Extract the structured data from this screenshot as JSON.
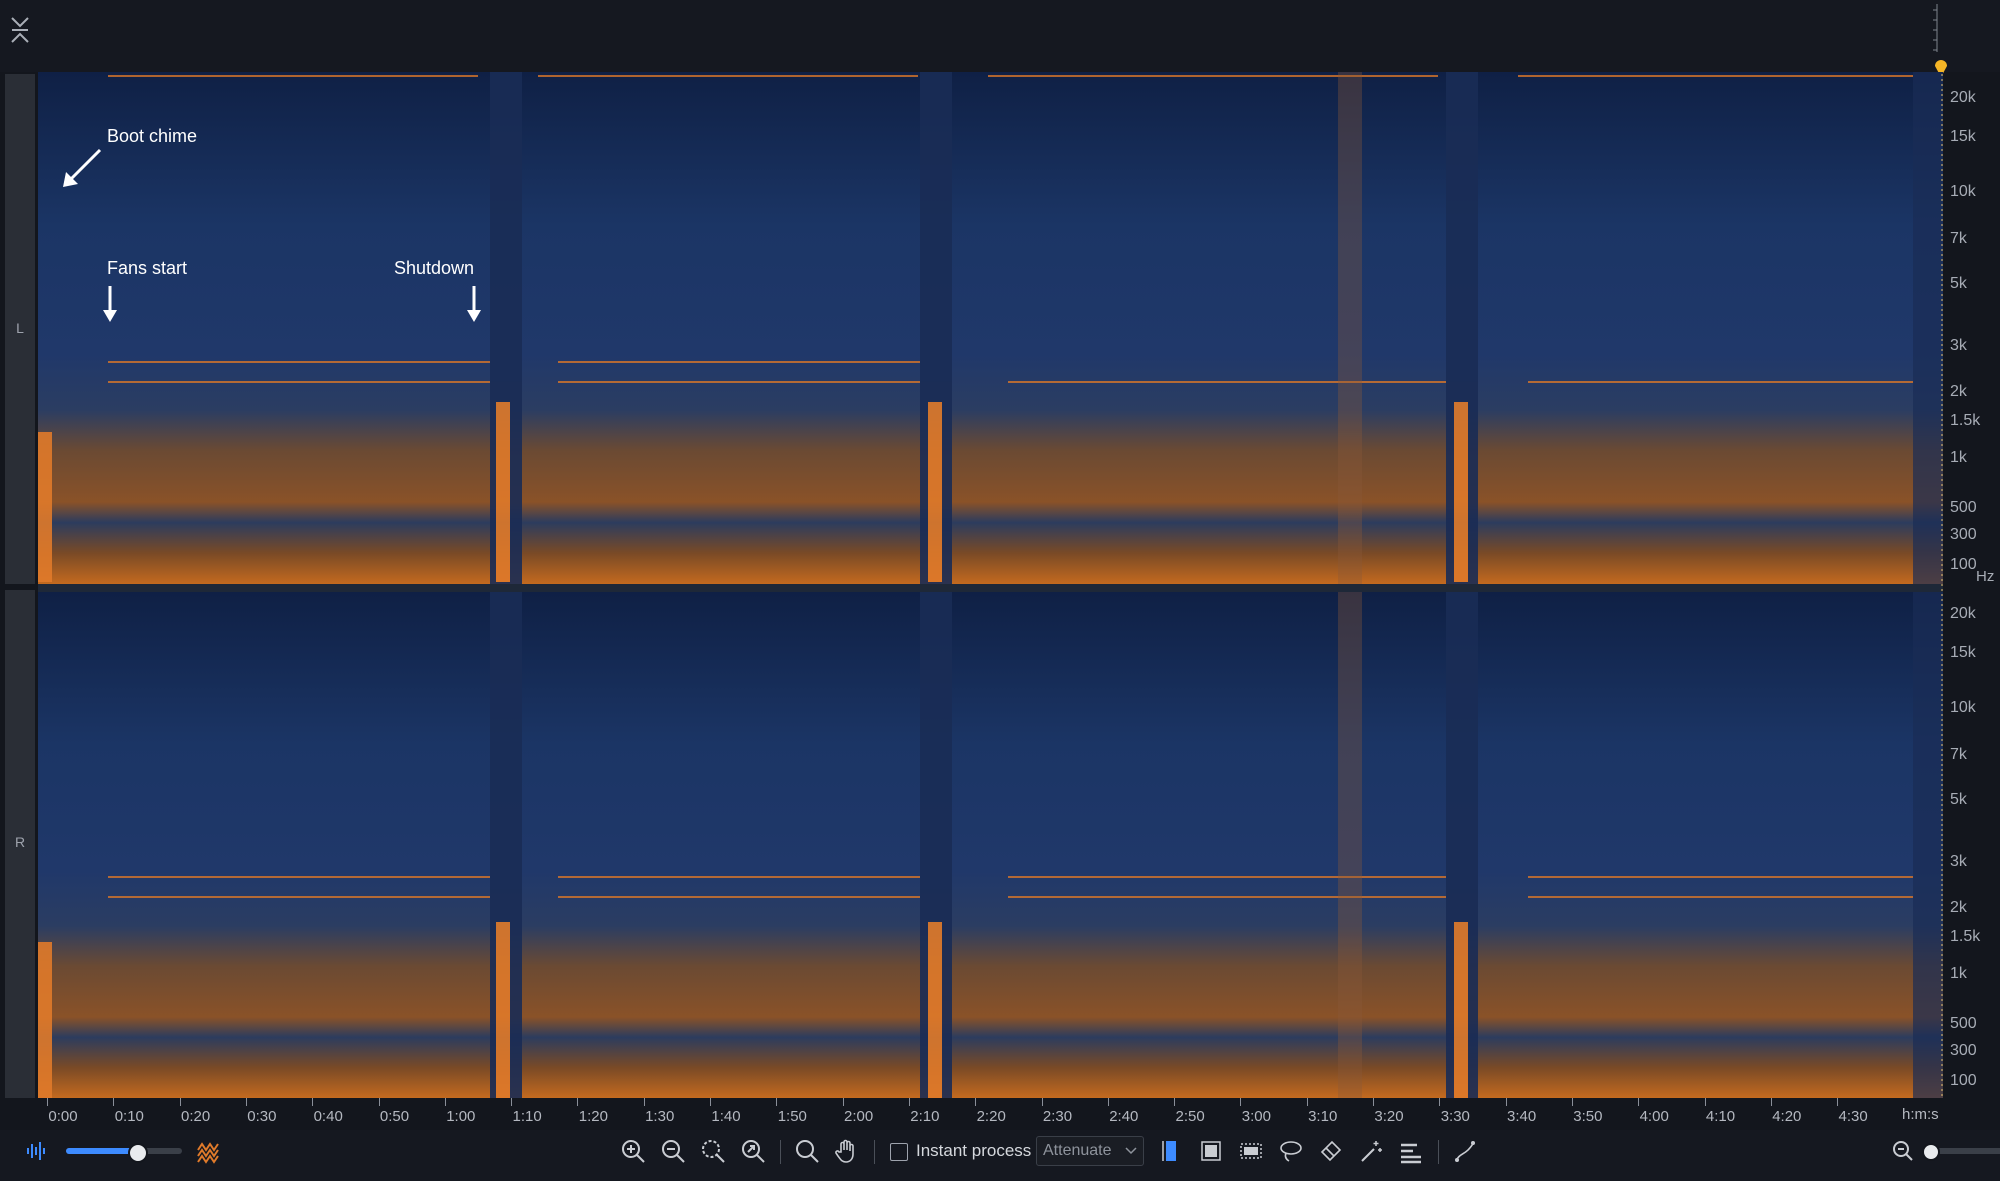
{
  "channels": {
    "left_label": "L",
    "right_label": "R"
  },
  "freq_labels": [
    "20k",
    "15k",
    "10k",
    "7k",
    "5k",
    "3k",
    "2k",
    "1.5k",
    "1k",
    "500",
    "300",
    "100"
  ],
  "freq_unit": "Hz",
  "time_labels": [
    "0:00",
    "0:10",
    "0:20",
    "0:30",
    "0:40",
    "0:50",
    "1:00",
    "1:10",
    "1:20",
    "1:30",
    "1:40",
    "1:50",
    "2:00",
    "2:10",
    "2:20",
    "2:30",
    "2:40",
    "2:50",
    "3:00",
    "3:10",
    "3:20",
    "3:30",
    "3:40",
    "3:50",
    "4:00",
    "4:10",
    "4:20",
    "4:30"
  ],
  "time_unit": "h:m:s",
  "annotations": {
    "boot_chime": "Boot chime",
    "fans_start": "Fans start",
    "shutdown": "Shutdown"
  },
  "toolbar": {
    "instant_process_label": "Instant process",
    "instant_process_checked": false,
    "mode_selected": "Attenuate",
    "opacity_level": 0.6
  },
  "colors": {
    "accent": "#3d8bff",
    "playhead": "#f5b526",
    "spectral_hot": "#e0742a",
    "spectral_cold": "#1b3565"
  },
  "icons": [
    "collapse-icon",
    "waveform-view-icon",
    "spectrogram-view-icon",
    "zoom-in-icon",
    "zoom-out-icon",
    "zoom-selection-icon",
    "zoom-fit-icon",
    "magnify-icon",
    "hand-icon",
    "time-select-icon",
    "time-freq-select-icon",
    "freq-select-icon",
    "lasso-icon",
    "brush-icon",
    "magic-wand-icon",
    "harmonic-select-icon",
    "pencil-curve-icon",
    "zoom-out-small-icon"
  ]
}
